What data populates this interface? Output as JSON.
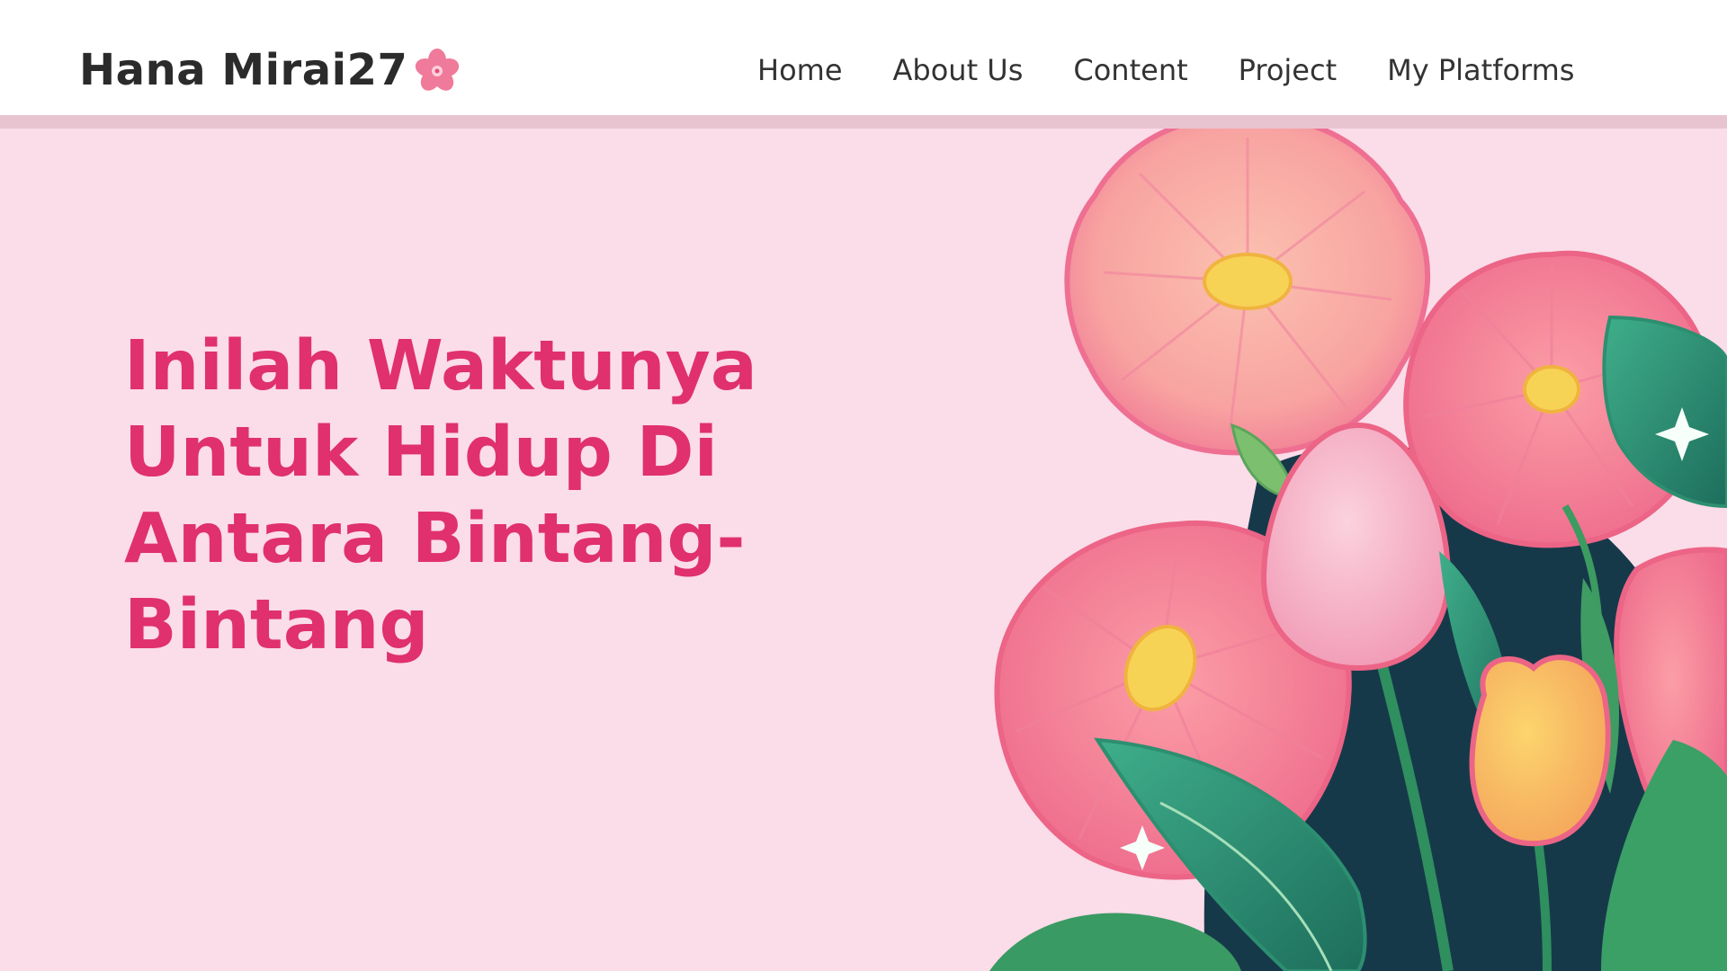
{
  "header": {
    "brand": "Hana Mirai27",
    "brand_icon": "cherry-blossom-icon",
    "nav_items": [
      {
        "label": "Home"
      },
      {
        "label": "About Us"
      },
      {
        "label": "Content"
      },
      {
        "label": "Project"
      },
      {
        "label": "My Platforms"
      }
    ]
  },
  "hero": {
    "title": "Inilah Waktunya Untuk Hidup Di Antara Bintang-Bintang",
    "illustration": "pink-flowers-illustration"
  },
  "colors": {
    "background": "#fbdce9",
    "accent": "#e0306e",
    "nav_text": "#333333",
    "header_border": "#e8c4d1"
  }
}
